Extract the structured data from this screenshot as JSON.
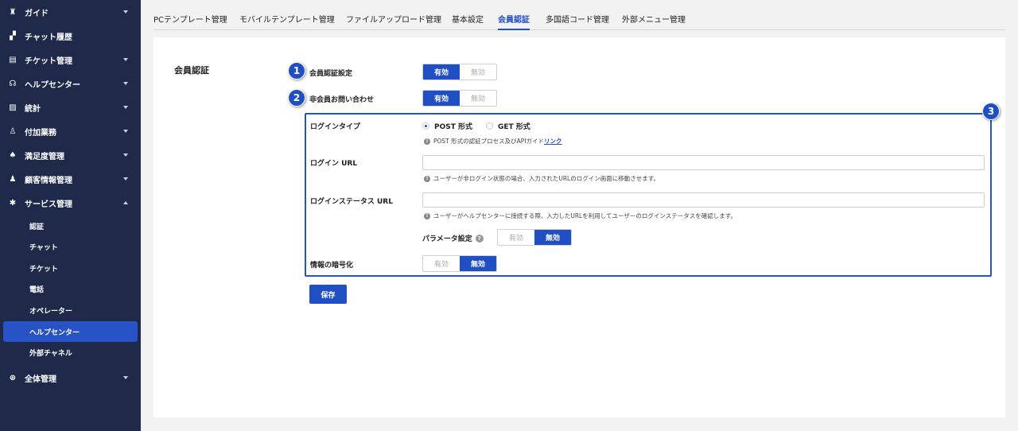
{
  "sidebar": {
    "items": [
      {
        "label": "ガイド",
        "icon": "trophy-icon"
      },
      {
        "label": "チャット履歴",
        "icon": "chat-icon"
      },
      {
        "label": "チケット管理",
        "icon": "document-icon"
      },
      {
        "label": "ヘルプセンター",
        "icon": "headset-icon"
      },
      {
        "label": "統計",
        "icon": "chart-icon"
      },
      {
        "label": "付加業務",
        "icon": "user-add-icon"
      },
      {
        "label": "満足度管理",
        "icon": "thumbs-up-icon"
      },
      {
        "label": "顧客情報管理",
        "icon": "user-icon"
      },
      {
        "label": "サービス管理",
        "icon": "gear-icon"
      }
    ],
    "sub_items": [
      "認証",
      "チャット",
      "チケット",
      "電話",
      "オペレーター",
      "ヘルプセンター",
      "外部チャネル"
    ],
    "bottom_item": {
      "label": "全体管理",
      "icon": "plus-circle-icon"
    }
  },
  "tabs": [
    "PCテンプレート管理",
    "モバイルテンプレート管理",
    "ファイルアップロード管理",
    "基本設定",
    "会員認証",
    "多国語コード管理",
    "外部メニュー管理"
  ],
  "main": {
    "section_title": "会員認証",
    "badges": [
      "1",
      "2",
      "3"
    ],
    "member_auth_label": "会員認証設定",
    "nonmember_label": "非会員お問い合わせ",
    "on": "有効",
    "off": "無効",
    "login_type_label": "ログインタイプ",
    "post_option": "POST 形式",
    "get_option": "GET 形式",
    "post_hint": "POST 形式の認証プロセス及びAPIガイド",
    "post_hint_link": "リンク",
    "login_url_label": "ログイン URL",
    "login_url_hint": "ユーザーが非ログイン状態の場合、入力されたURLのログイン画面に移動させます。",
    "login_status_label": "ログインステータス URL",
    "login_status_hint": "ユーザーがヘルプセンターに接続する際、入力したURLを利用してユーザーのログインステータスを確認します。",
    "param_label": "パラメータ設定",
    "encrypt_label": "情報の暗号化",
    "save": "保存"
  },
  "colors": {
    "sidebar": "#1f2a4a",
    "accent": "#1f4fc3",
    "active_sub": "#2753c6"
  }
}
